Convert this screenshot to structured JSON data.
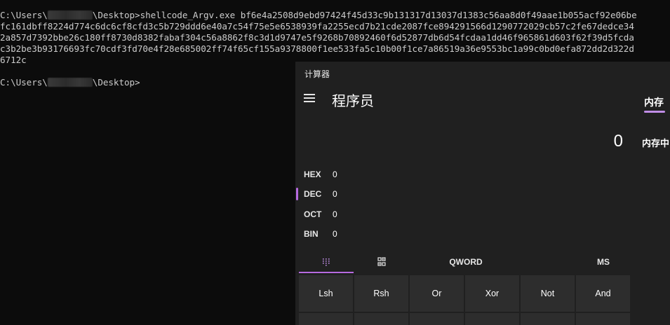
{
  "console": {
    "line1_prefix": "C:\\Users\\",
    "line1_suffix": "\\Desktop>shellcode_Argv.exe bf6e4a2508d9ebd97424f45d33c9b131317d13037d1383c56aa8d0f49aae1b055acf92e06be",
    "line2": "fc161dbff8224d774c6dc6cf8cfd3c5b729ddd6e40a7c54f75e5e6538939fa2255ecd7b21cde2087fce894291566d1290772029cb57c2fe67dedce34",
    "line3": "2a857d7392bbe26c180ff8730d8382fabaf304c56a8862f8c3d1d9747e5f9268b70892460f6d52877db6d54fcdaa1dd46f965861d603f62f39d5fcda",
    "line4": "c3b2be3b93176693fc70cdf3fd70e4f28e685002ff74f65cf155a9378800f1ee533fa5c10b00f1ce7a86519a36e9553bc1a99c0bd0efa872dd2d322d",
    "line5": "6712c",
    "line6_prefix": "C:\\Users\\",
    "line6_suffix": "\\Desktop>"
  },
  "calculator": {
    "window_title": "计算器",
    "mode": "程序员",
    "memory_tab": "内存",
    "display_value": "0",
    "memory_empty_text": "内存中",
    "radix": [
      {
        "label": "HEX",
        "value": "0"
      },
      {
        "label": "DEC",
        "value": "0"
      },
      {
        "label": "OCT",
        "value": "0"
      },
      {
        "label": "BIN",
        "value": "0"
      }
    ],
    "selected_radix": "DEC",
    "word_size": "QWORD",
    "memory_store": "MS",
    "keys_row1": [
      "Lsh",
      "Rsh",
      "Or",
      "Xor",
      "Not",
      "And"
    ],
    "accent_color": "#b66ae0"
  }
}
